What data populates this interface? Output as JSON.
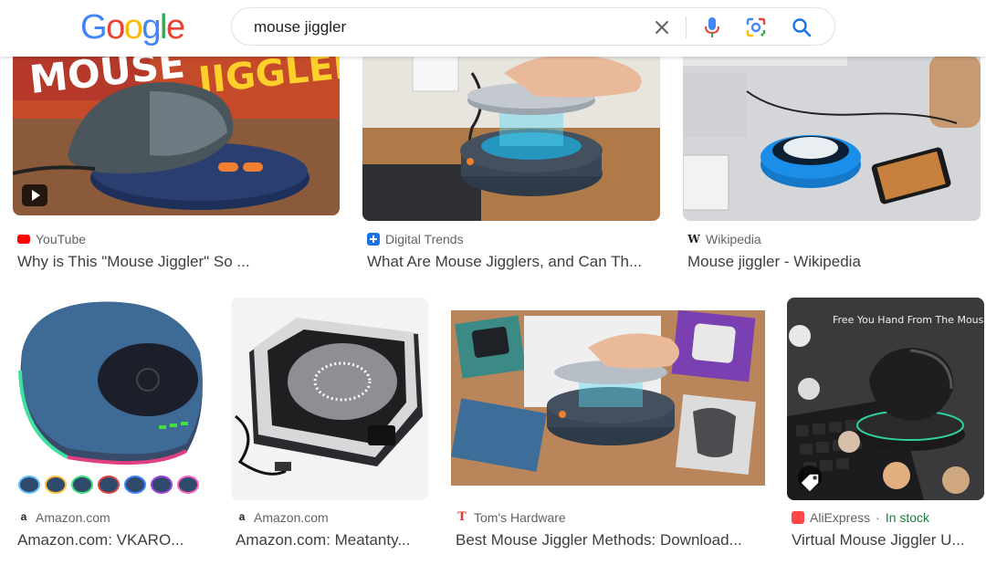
{
  "header": {
    "logo_letters": [
      {
        "ch": "G",
        "color": "#4285F4"
      },
      {
        "ch": "o",
        "color": "#EA4335"
      },
      {
        "ch": "o",
        "color": "#FBBC05"
      },
      {
        "ch": "g",
        "color": "#4285F4"
      },
      {
        "ch": "l",
        "color": "#34A853"
      },
      {
        "ch": "e",
        "color": "#EA4335"
      }
    ],
    "search_query": "mouse jiggler",
    "icons": [
      "close-icon",
      "microphone-icon",
      "google-lens-icon",
      "search-icon"
    ]
  },
  "results": [
    {
      "source": "YouTube",
      "favicon": "youtube-icon",
      "favicon_color": "#FF0000",
      "title": "Why is This \"Mouse Jiggler\" So ...",
      "overlay": "play-icon"
    },
    {
      "source": "Digital Trends",
      "favicon": "digital-trends-icon",
      "favicon_color": "#1A73E8",
      "title": "What Are Mouse Jigglers, and Can Th..."
    },
    {
      "source": "Wikipedia",
      "favicon": "wikipedia-icon",
      "favicon_color": "#202124",
      "title": "Mouse jiggler - Wikipedia"
    },
    {
      "source": "Amazon.com",
      "favicon": "amazon-icon",
      "favicon_color": "#FF9900",
      "title": "Amazon.com: VKARO..."
    },
    {
      "source": "Amazon.com",
      "favicon": "amazon-icon",
      "favicon_color": "#FF9900",
      "title": "Amazon.com: Meatanty..."
    },
    {
      "source": "Tom's Hardware",
      "favicon": "toms-hardware-icon",
      "favicon_color": "#E53935",
      "title": "Best Mouse Jiggler Methods: Download..."
    },
    {
      "source": "AliExpress",
      "favicon": "aliexpress-icon",
      "favicon_color": "#FF4747",
      "title": "Virtual Mouse Jiggler U...",
      "stock": "In stock",
      "overlay": "tag-icon"
    }
  ],
  "image_texts": {
    "yt_thumb_left": "MOUSE",
    "yt_thumb_right": "JIGGLER?",
    "ali_thumb_banner": "Free You Hand From The Mouse"
  },
  "colors": {
    "accent_blue": "#1A73E8",
    "stock_green": "#188038"
  }
}
